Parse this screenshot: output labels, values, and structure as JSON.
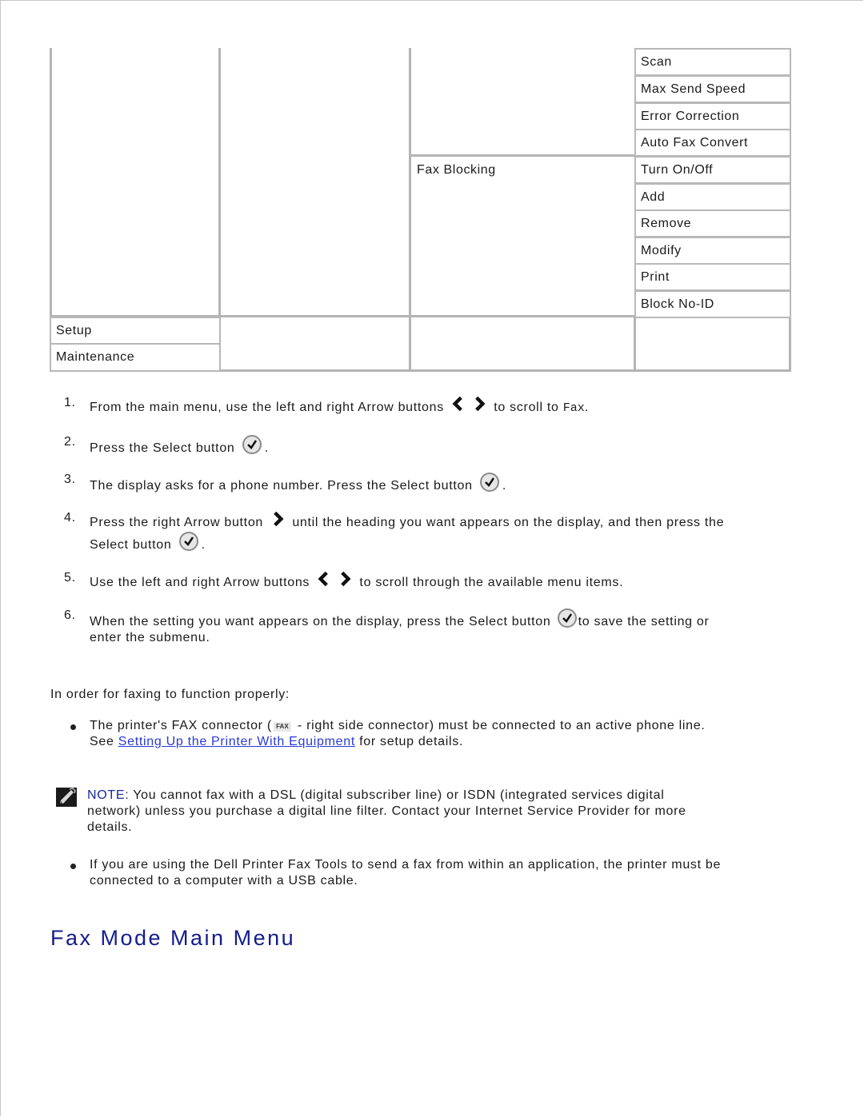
{
  "table": {
    "col4_group1": [
      "Scan",
      "Max Send Speed",
      "Error Correction",
      "Auto Fax Convert"
    ],
    "col3_fax_blocking": "Fax Blocking",
    "col4_group2": [
      "Turn On/Off",
      "Add",
      "Remove",
      "Modify",
      "Print",
      "Block No-ID"
    ],
    "col1_bottom": [
      "Setup",
      "Maintenance"
    ]
  },
  "steps": [
    {
      "num": "1.",
      "before": "From the main menu, use the left and right Arrow buttons",
      "after": " to scroll to ",
      "code": "Fax",
      "end": "."
    },
    {
      "num": "2.",
      "before": "Press the Select button",
      "after": "."
    },
    {
      "num": "3.",
      "before": "The display asks for a phone number. Press the Select button",
      "after": "."
    },
    {
      "num": "4.",
      "before": "Press the right Arrow button",
      "middle": " until the heading you want appears on the display, and then press the",
      "line2": "Select button",
      "after": "."
    },
    {
      "num": "5.",
      "before": "Use the left and right Arrow buttons",
      "after": " to scroll through the available menu items."
    },
    {
      "num": "6.",
      "before": "When the setting you want appears on the display, press the Select button",
      "after": "to save the setting or",
      "line2": "enter the submenu."
    }
  ],
  "intro": "In order for faxing to function properly:",
  "bullet1": {
    "before": "The printer's FAX connector (",
    "icon_label": "FAX",
    "after": "- right side connector) must be connected to an active phone line.",
    "line2_before": "See ",
    "link": "Setting Up the Printer With Equipment",
    "line2_after": " for setup details."
  },
  "note": {
    "label": "NOTE:",
    "text": " You cannot fax with a DSL (digital subscriber line) or ISDN (integrated services digital",
    "line2": "network) unless you purchase a digital line filter. Contact your Internet Service Provider for more",
    "line3": "details."
  },
  "bullet2": {
    "line1": "If you are using the Dell Printer Fax Tools to send a fax from within an application, the printer must be",
    "line2": "connected to a computer with a USB cable."
  },
  "section_title": "Fax Mode Main Menu",
  "colors": {
    "link": "#2a3ad8",
    "heading": "#141c8c",
    "note_label": "#1a2a9a",
    "table_border": "#b4b4b4"
  }
}
